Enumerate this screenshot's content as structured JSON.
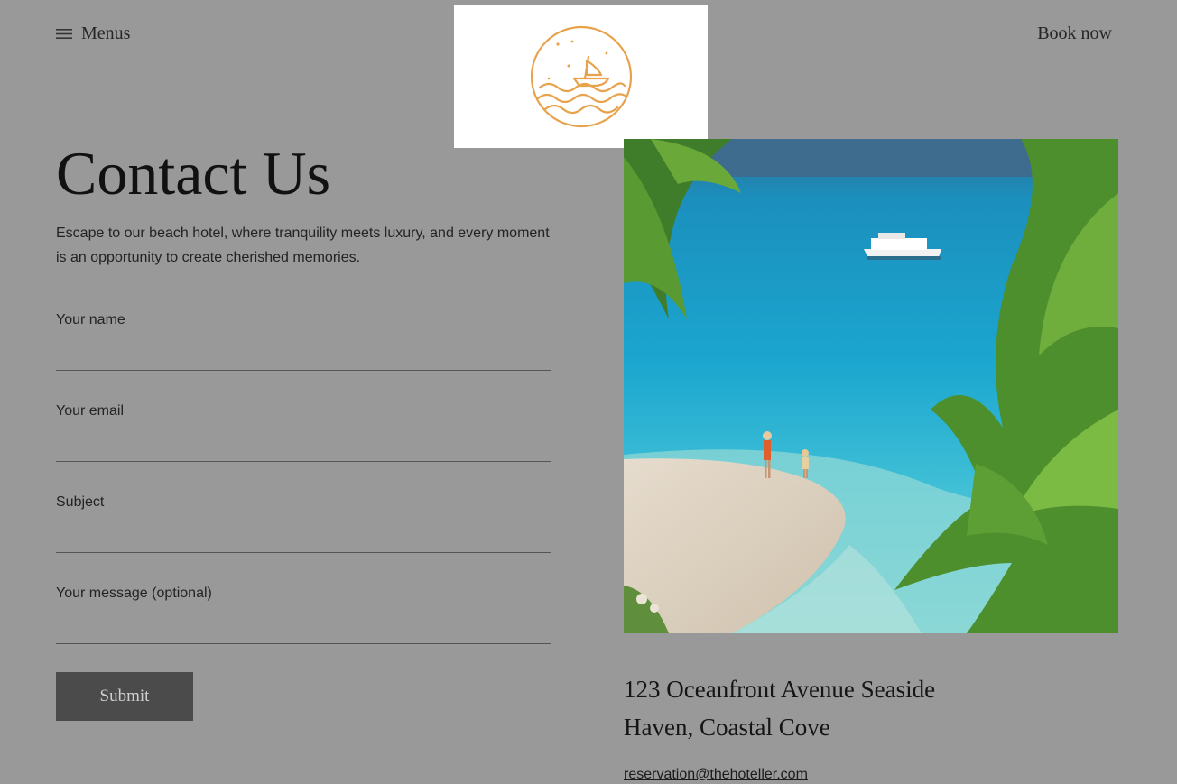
{
  "header": {
    "menu_label": "Menus",
    "menu_icon": "hamburger-icon",
    "book_label": "Book now",
    "logo_icon": "sailboat-waves-logo",
    "logo_color": "#E8A24B"
  },
  "contact": {
    "title": "Contact Us",
    "intro": "Escape to our beach hotel, where tranquility meets luxury, and every moment is an opportunity to create cherished memories."
  },
  "form": {
    "fields": [
      {
        "label": "Your name",
        "value": ""
      },
      {
        "label": "Your email",
        "value": ""
      },
      {
        "label": "Subject",
        "value": ""
      },
      {
        "label": "Your message (optional)",
        "value": ""
      }
    ],
    "submit_label": "Submit"
  },
  "info": {
    "address_line1": "123 Oceanfront Avenue Seaside",
    "address_line2": "Haven, Coastal Cove",
    "email": "reservation@thehoteller.com"
  },
  "colors": {
    "background": "#999999",
    "button": "#4B4B4B",
    "ocean": "#2BA7C9"
  }
}
